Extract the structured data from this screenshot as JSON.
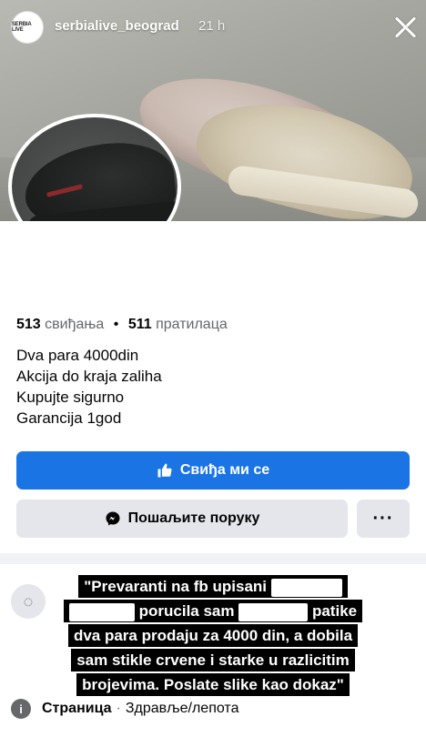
{
  "story": {
    "username": "serbialive_beograd",
    "time": "21 h",
    "avatar_text": "SERBIA LIVE"
  },
  "page": {
    "likes_count": "513",
    "likes_label": "свиђања",
    "followers_count": "511",
    "followers_label": "пратилаца",
    "bio_lines": [
      "Dva para 4000din",
      "Akcija do kraja zaliha",
      "Kupujte sigurno",
      "Garancija 1god"
    ],
    "like_button": "Свиђа ми се",
    "message_button": "Пошаљите поруку",
    "more_button": "···",
    "type_label": "Страница",
    "category": "Здравље/лепота"
  },
  "caption": {
    "line1": "\"Prevaranti na fb upisani",
    "line2": "porucila sam",
    "line2b": "patike",
    "line3": "dva para prodaju za 4000 din, a dobila",
    "line4": "sam stikle crvene i starke u razlicitim",
    "line5": "brojevima. Poslate slike kao dokaz\""
  },
  "colors": {
    "primary_blue": "#1b74e4",
    "secondary_gray": "#e4e6eb"
  }
}
